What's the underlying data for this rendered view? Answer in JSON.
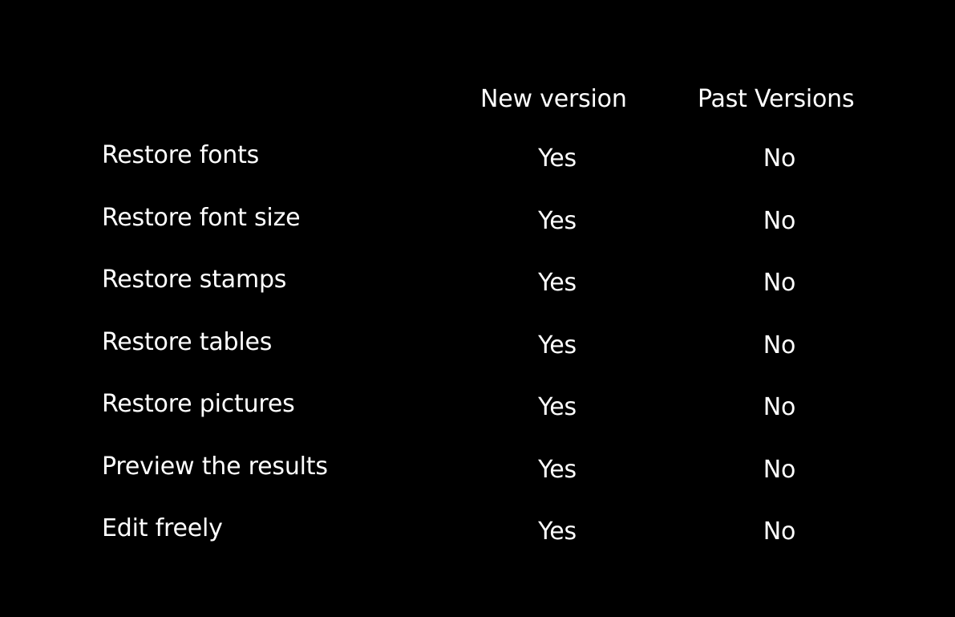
{
  "header": {
    "new_version": "New version",
    "past_versions": "Past Versions"
  },
  "rows": [
    {
      "feature": "Restore fonts",
      "new": "Yes",
      "past": "No"
    },
    {
      "feature": "Restore font size",
      "new": "Yes",
      "past": "No"
    },
    {
      "feature": "Restore stamps",
      "new": "Yes",
      "past": "No"
    },
    {
      "feature": "Restore tables",
      "new": "Yes",
      "past": "No"
    },
    {
      "feature": "Restore pictures",
      "new": "Yes",
      "past": "No"
    },
    {
      "feature": "Preview the results",
      "new": "Yes",
      "past": "No"
    },
    {
      "feature": "Edit freely",
      "new": "Yes",
      "past": "No"
    }
  ],
  "colors": {
    "background": "#000000",
    "text": "#ffffff"
  }
}
